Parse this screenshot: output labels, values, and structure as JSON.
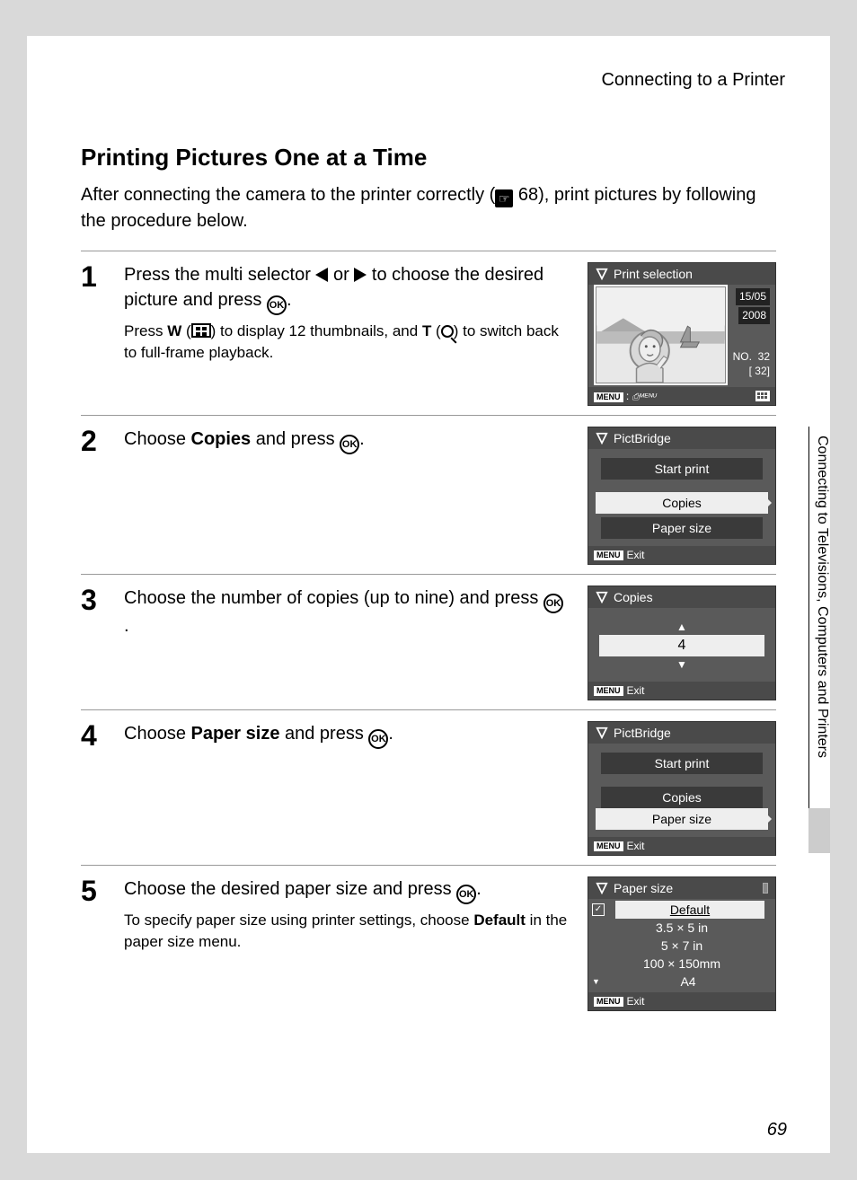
{
  "header": {
    "section_title": "Connecting to a Printer"
  },
  "sidebar": {
    "label": "Connecting to Televisions, Computers and Printers"
  },
  "title": "Printing Pictures One at a Time",
  "intro": {
    "prefix": "After connecting the camera to the printer correctly (",
    "ref_page": "68",
    "suffix": "), print pictures by following the procedure below."
  },
  "steps": [
    {
      "num": "1",
      "main_pre": "Press the multi selector ",
      "main_mid": " or ",
      "main_post": " to choose the desired picture and press ",
      "sub_pre": "Press ",
      "sub_w": "W",
      "sub_mid1": " (",
      "sub_mid2": ") to display 12 thumbnails, and ",
      "sub_t": "T",
      "sub_mid3": " (",
      "sub_post": ") to switch back to full-frame playback.",
      "ok": "OK"
    },
    {
      "num": "2",
      "main_pre": "Choose ",
      "main_bold": "Copies",
      "main_post": " and press ",
      "ok": "OK"
    },
    {
      "num": "3",
      "main_pre": "Choose the number of copies (up to nine) and press ",
      "ok": "OK"
    },
    {
      "num": "4",
      "main_pre": "Choose ",
      "main_bold": "Paper size",
      "main_post": " and press ",
      "ok": "OK"
    },
    {
      "num": "5",
      "main_pre": "Choose the desired paper size and press ",
      "sub_pre": "To specify paper size using printer settings, choose ",
      "sub_bold": "Default",
      "sub_post": " in the paper size menu.",
      "ok": "OK"
    }
  ],
  "lcd1": {
    "title": "Print selection",
    "date1": "15/05",
    "date2": "2008",
    "no_label": "NO.",
    "no_val": "32",
    "count": "[    32]",
    "menu": "MENU"
  },
  "lcd2": {
    "title": "PictBridge",
    "items": [
      "Start print",
      "Copies",
      "Paper size"
    ],
    "selected": 1,
    "menu": "MENU",
    "exit": "Exit"
  },
  "lcd3": {
    "title": "Copies",
    "value": "4",
    "menu": "MENU",
    "exit": "Exit"
  },
  "lcd4": {
    "title": "PictBridge",
    "items": [
      "Start print",
      "Copies",
      "Paper size"
    ],
    "selected": 2,
    "menu": "MENU",
    "exit": "Exit"
  },
  "lcd5": {
    "title": "Paper size",
    "items": [
      "Default",
      "3.5 × 5 in",
      "5 × 7 in",
      "100 × 150mm",
      "A4"
    ],
    "selected": 0,
    "menu": "MENU",
    "exit": "Exit"
  },
  "page_number": "69"
}
